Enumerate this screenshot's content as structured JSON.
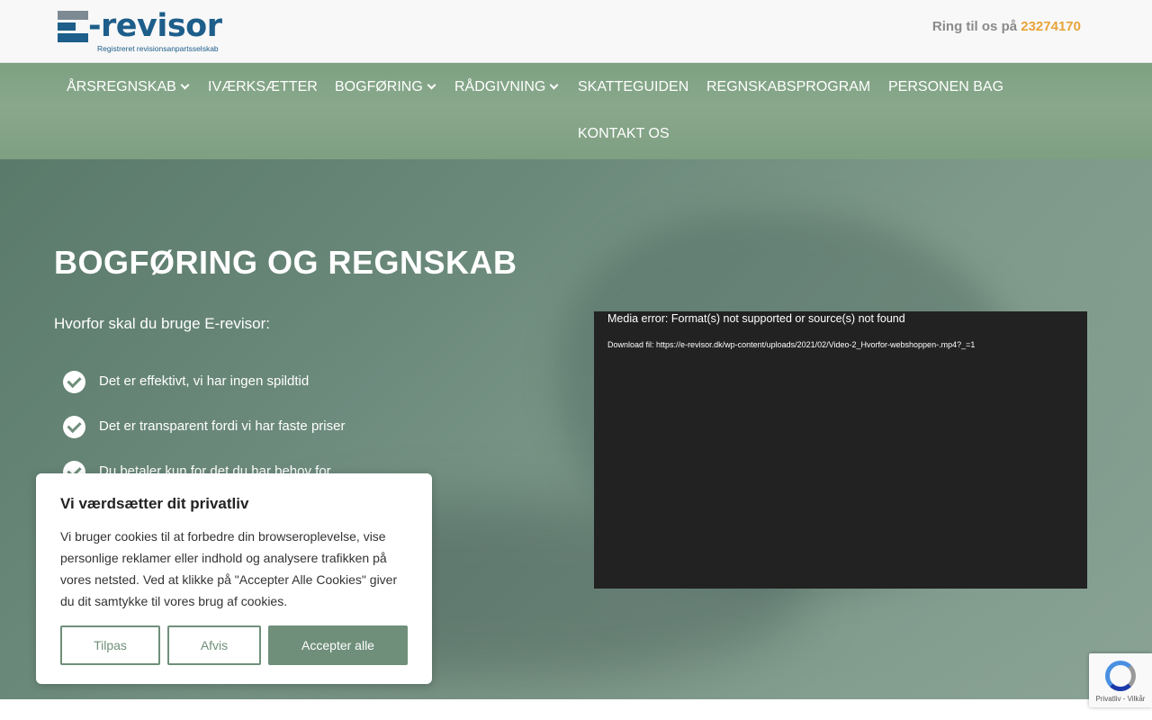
{
  "header": {
    "logo_text": "E-revisor",
    "logo_word": "-revisor",
    "logo_sub": "Registreret revisionsanpartsselskab",
    "phone_prefix": "Ring til os på",
    "phone_number": "23274170"
  },
  "nav": {
    "items": [
      {
        "label": "ÅRSREGNSKAB",
        "dropdown": true
      },
      {
        "label": "IVÆRKSÆTTER",
        "dropdown": false
      },
      {
        "label": "BOGFØRING",
        "dropdown": true
      },
      {
        "label": "RÅDGIVNING",
        "dropdown": true
      },
      {
        "label": "SKATTEGUIDEN",
        "dropdown": false
      },
      {
        "label": "REGNSKABSPROGRAM",
        "dropdown": false
      },
      {
        "label": "PERSONEN BAG",
        "dropdown": false
      },
      {
        "label": "KONTAKT OS",
        "dropdown": false
      }
    ]
  },
  "hero": {
    "title": "BOGFØRING OG REGNSKAB",
    "subtitle": "Hvorfor skal du bruge E-revisor:",
    "benefits": [
      "Det er effektivt, vi har ingen spildtid",
      "Det er transparent fordi vi har faste priser",
      "Du betaler kun for det du har behov for"
    ]
  },
  "video": {
    "error": "Media error: Format(s) not supported or source(s) not found",
    "download_prefix": "Download fil:",
    "download_url": "https://e-revisor.dk/wp-content/uploads/2021/02/Video-2_Hvorfor-webshoppen-.mp4?_=1"
  },
  "cookie": {
    "title": "Vi værdsætter dit privatliv",
    "body": "Vi bruger cookies til at forbedre din browseroplevelse, vise personlige reklamer eller indhold og analysere trafikken på vores netsted. Ved at klikke på \"Accepter Alle Cookies\" giver du dit samtykke til vores brug af cookies.",
    "customize_label": "Tilpas",
    "reject_label": "Afvis",
    "accept_label": "Accepter alle"
  },
  "recaptcha": {
    "text": "Privatliv - Vilkår"
  },
  "colors": {
    "accent": "#6f8f7a",
    "phone": "#e8a33a",
    "brand": "#1d5e8a"
  }
}
